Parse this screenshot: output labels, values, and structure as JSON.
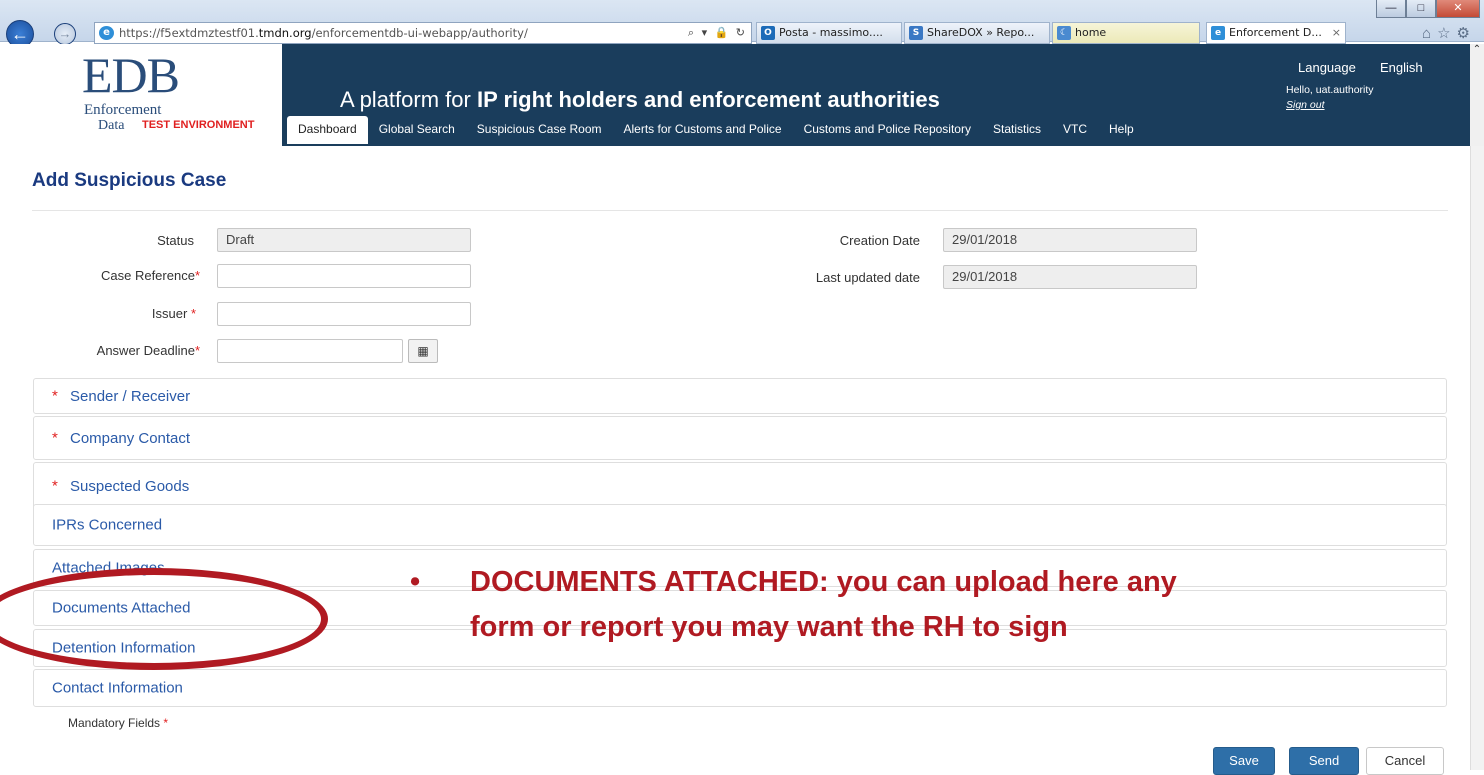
{
  "browser": {
    "url_prefix": "https://f5extdmztestf01.",
    "url_domain": "tmdn.org",
    "url_path": "/enforcementdb-ui-webapp/authority/",
    "address_tools": "⌕ ▾ 🔒 ↻",
    "tabs": [
      {
        "label": "Posta - massimo....",
        "icon": "outlook-icon"
      },
      {
        "label": "ShareDOX » Repo...",
        "icon": "sharedox-icon"
      },
      {
        "label": "home",
        "icon": "page-icon"
      },
      {
        "label": "Enforcement D...",
        "icon": "ie-icon",
        "active": true
      }
    ],
    "window_buttons": [
      "—",
      "□",
      "✕"
    ]
  },
  "header": {
    "logo_main": "EDB",
    "logo_line1": "Enforcement",
    "logo_line2": "Data",
    "test_env": "TEST ENVIRONMENT",
    "platform_prefix": "A platform for ",
    "platform_bold": "IP right holders and enforcement authorities",
    "language_label": "Language",
    "language_value": "English",
    "greeting": "Hello, uat.authority",
    "sign_out": "Sign out",
    "nav": [
      "Dashboard",
      "Global Search",
      "Suspicious Case Room",
      "Alerts for Customs and Police",
      "Customs and Police Repository",
      "Statistics",
      "VTC",
      "Help"
    ]
  },
  "form": {
    "title": "Add Suspicious Case",
    "status_label": "Status",
    "status_value": "Draft",
    "case_ref_label": "Case Reference",
    "case_ref_value": "",
    "issuer_label": "Issuer ",
    "issuer_value": "",
    "deadline_label": "Answer Deadline",
    "deadline_value": "",
    "creation_label": "Creation Date",
    "creation_value": "29/01/2018",
    "updated_label": "Last updated date",
    "updated_value": "29/01/2018",
    "required_mark": "*"
  },
  "sections": [
    {
      "label": "Sender / Receiver",
      "required": true
    },
    {
      "label": "Company Contact",
      "required": true
    },
    {
      "label": "Suspected Goods",
      "required": true
    },
    {
      "label": "IPRs Concerned",
      "required": false
    },
    {
      "label": "Attached Images",
      "required": false
    },
    {
      "label": "Documents Attached",
      "required": false
    },
    {
      "label": "Detention Information",
      "required": false
    },
    {
      "label": "Contact Information",
      "required": false
    }
  ],
  "mandatory_note": "Mandatory Fields ",
  "actions": {
    "save": "Save",
    "send": "Send",
    "cancel": "Cancel"
  },
  "annotation": {
    "bullet": "•",
    "text": "DOCUMENTS ATTACHED: you can upload here any form or report you may want the RH to sign",
    "color": "#b01a22"
  }
}
